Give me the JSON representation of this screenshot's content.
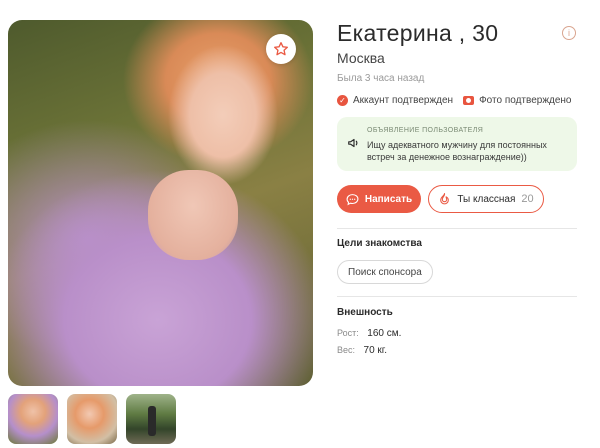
{
  "profile": {
    "name": "Екатерина , 30",
    "city": "Москва",
    "last_seen": "Была 3 часа назад",
    "account_verified": "Аккаунт подтвержден",
    "photo_verified": "Фото подтверждено"
  },
  "ad": {
    "title": "ОБЪЯВЛЕНИЕ ПОЛЬЗОВАТЕЛЯ",
    "text": "Ищу адекватного мужчину для постоянных встреч за денежное вознаграждение))"
  },
  "actions": {
    "write_label": "Написать",
    "cool_label": "Ты классная",
    "cool_count": "20"
  },
  "goals": {
    "title": "Цели знакомства",
    "items": [
      "Поиск спонсора"
    ]
  },
  "appearance": {
    "title": "Внешность",
    "height_label": "Рост:",
    "height_value": "160 см.",
    "weight_label": "Вес:",
    "weight_value": "70 кг."
  },
  "icons": {
    "favorite": "star-icon",
    "info": "info-icon",
    "verified": "check-icon",
    "photo": "camera-icon",
    "ad": "megaphone-icon",
    "write": "chat-icon",
    "cool": "flame-icon"
  },
  "colors": {
    "accent": "#ea5a44",
    "ad_background": "#eef8e8"
  }
}
